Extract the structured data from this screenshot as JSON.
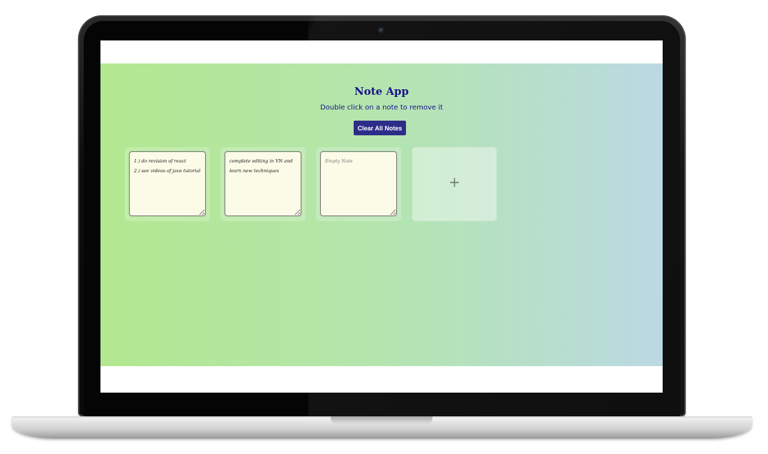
{
  "app": {
    "title": "Note App",
    "subtitle": "Double click on a note to remove it",
    "clear_button_label": "Clear All Notes",
    "add_note_symbol": "+"
  },
  "notes": [
    {
      "text": "1.) do revision of react\n2.) see videos of java tutorial",
      "placeholder": "Empty Note"
    },
    {
      "text": "complete editing in VN and learn new techniques",
      "placeholder": "Empty Note"
    },
    {
      "text": "",
      "placeholder": "Empty Note"
    }
  ],
  "colors": {
    "title_color": "#1a128c",
    "button_color": "#2c2d88",
    "note_background": "#fcfbe8",
    "gradient_start": "#b3e890",
    "gradient_end": "#bad9e3"
  },
  "icons": {
    "camera": "camera-icon",
    "add": "plus-icon"
  }
}
